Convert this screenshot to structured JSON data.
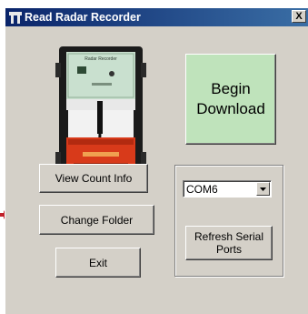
{
  "window": {
    "title": "Read Radar Recorder",
    "close_label": "X"
  },
  "device_image": {
    "label": "Radar Recorder"
  },
  "buttons": {
    "begin_download": "Begin Download",
    "view_count_info": "View Count Info",
    "change_folder": "Change Folder",
    "exit": "Exit",
    "refresh_serial_ports": "Refresh Serial Ports"
  },
  "port_select": {
    "value": "COM6"
  },
  "colors": {
    "begin_download_bg": "#bfe3bb",
    "window_bg": "#d4d0c8",
    "title_bar": "#0a246a"
  }
}
